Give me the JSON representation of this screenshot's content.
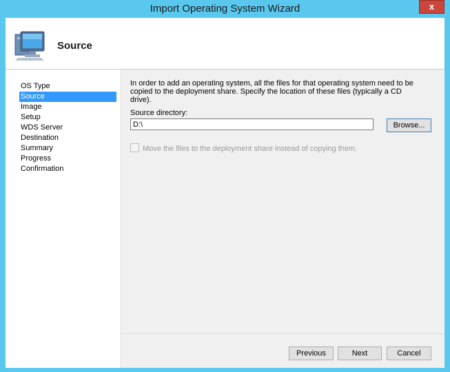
{
  "window": {
    "title": "Import Operating System Wizard",
    "close_label": "x"
  },
  "header": {
    "title": "Source",
    "icon": "computer-monitor-icon"
  },
  "nav": {
    "items": [
      {
        "label": "OS Type",
        "selected": false
      },
      {
        "label": "Source",
        "selected": true
      },
      {
        "label": "Image",
        "selected": false
      },
      {
        "label": "Setup",
        "selected": false
      },
      {
        "label": "WDS Server",
        "selected": false
      },
      {
        "label": "Destination",
        "selected": false
      },
      {
        "label": "Summary",
        "selected": false
      },
      {
        "label": "Progress",
        "selected": false
      },
      {
        "label": "Confirmation",
        "selected": false
      }
    ]
  },
  "main": {
    "instructions": "In order to add an operating system, all the files for that operating system need to be copied to the deployment share.  Specify the location of these files (typically a CD drive).",
    "source_label": "Source directory:",
    "source_value": "D:\\",
    "browse_label": "Browse...",
    "move_files_label": "Move the files to the deployment share instead of copying them."
  },
  "footer": {
    "previous_label": "Previous",
    "next_label": "Next",
    "cancel_label": "Cancel"
  },
  "colors": {
    "frame": "#5ac8ee",
    "selection": "#3399ff",
    "close_button": "#c9463d"
  }
}
